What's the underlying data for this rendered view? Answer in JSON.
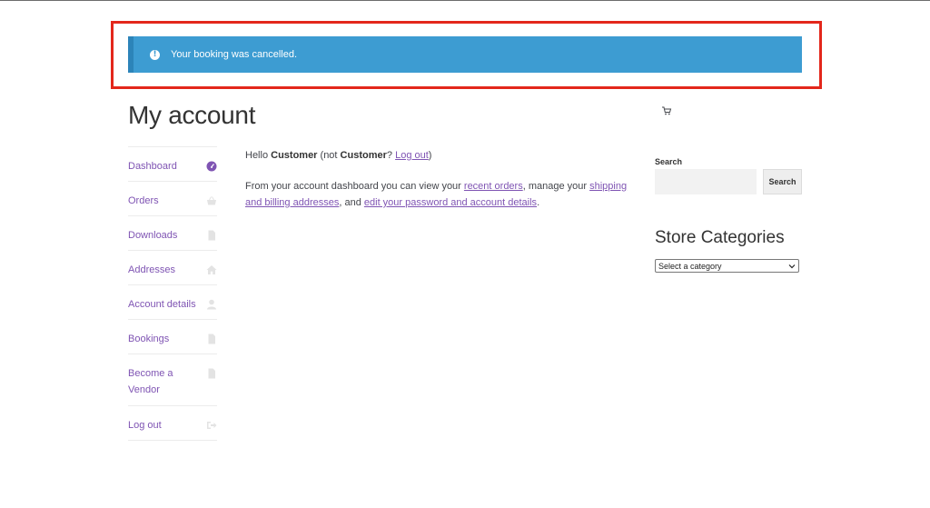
{
  "notice": {
    "message": "Your booking was cancelled.",
    "icon": "info-icon",
    "color": "#3d9cd2"
  },
  "page": {
    "title": "My account"
  },
  "account_nav": {
    "items": [
      {
        "label": "Dashboard",
        "icon": "dashboard-gauge-icon",
        "active": true
      },
      {
        "label": "Orders",
        "icon": "basket-icon"
      },
      {
        "label": "Downloads",
        "icon": "file-icon"
      },
      {
        "label": "Addresses",
        "icon": "home-icon"
      },
      {
        "label": "Account details",
        "icon": "user-icon"
      },
      {
        "label": "Bookings",
        "icon": "file-icon"
      },
      {
        "label": "Become a Vendor",
        "icon": "file-icon"
      },
      {
        "label": "Log out",
        "icon": "sign-out-icon"
      }
    ]
  },
  "dashboard": {
    "hello_prefix": "Hello ",
    "user_name": "Customer",
    "not_prefix": " (not ",
    "not_user": "Customer",
    "not_suffix": "? ",
    "logout_link": "Log out",
    "close_paren": ")",
    "intro_1": "From your account dashboard you can view your ",
    "recent_orders_link": "recent orders",
    "intro_2": ", manage your ",
    "addresses_link": "shipping and billing addresses",
    "intro_3": ", and ",
    "account_link": "edit your password and account details",
    "intro_4": "."
  },
  "sidebar": {
    "search_title": "Search",
    "search_placeholder": "",
    "search_button": "Search",
    "categories_title": "Store Categories",
    "categories_select": "Select a category"
  },
  "colors": {
    "accent": "#7f54b3",
    "highlight_border": "#e3271b"
  }
}
